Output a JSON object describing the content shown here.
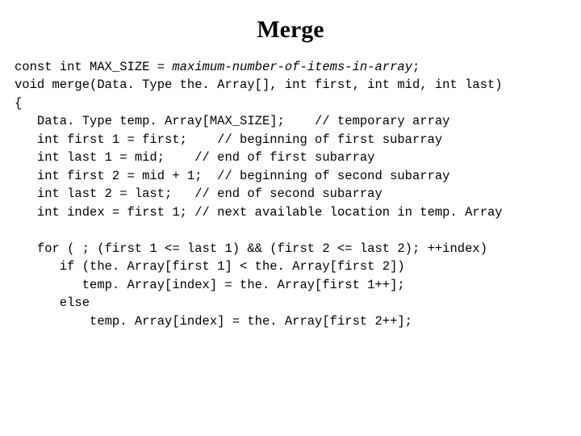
{
  "title": "Merge",
  "code": {
    "l1a": "const int MAX_SIZE = ",
    "l1b": "maximum-number-of-items-in-array",
    "l1c": ";",
    "l2": "void merge(Data. Type the. Array[], int first, int mid, int last)",
    "l3": "{",
    "l4": "   Data. Type temp. Array[MAX_SIZE];    // temporary array",
    "l5": "   int first 1 = first;    // beginning of first subarray",
    "l6": "   int last 1 = mid;    // end of first subarray",
    "l7": "   int first 2 = mid + 1;  // beginning of second subarray",
    "l8": "   int last 2 = last;   // end of second subarray",
    "l9": "   int index = first 1; // next available location in temp. Array",
    "l10": "",
    "l11": "   for ( ; (first 1 <= last 1) && (first 2 <= last 2); ++index)",
    "l12": "      if (the. Array[first 1] < the. Array[first 2])",
    "l13": "         temp. Array[index] = the. Array[first 1++];",
    "l14": "      else",
    "l15": "          temp. Array[index] = the. Array[first 2++];"
  }
}
